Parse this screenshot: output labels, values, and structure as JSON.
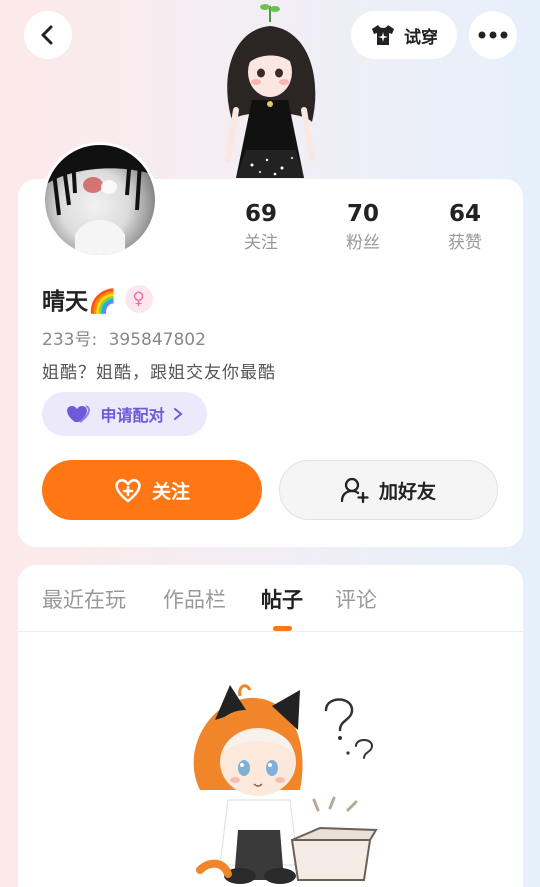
{
  "topbar": {
    "back_icon": "chevron-left-icon",
    "tryon_label": "试穿",
    "tryon_icon": "shirt-sparkle-icon",
    "more_icon": "more-dots-icon"
  },
  "profile": {
    "name": "晴天🌈",
    "gender_icon": "female-icon",
    "gender_symbol": "♀",
    "uid_label": "233号:",
    "uid": "395847802",
    "bio": "姐酷？姐酷，跟姐交友你最酷",
    "stats": [
      {
        "value": "69",
        "label": "关注"
      },
      {
        "value": "70",
        "label": "粉丝"
      },
      {
        "value": "64",
        "label": "获赞"
      }
    ],
    "pair_label": "申请配对",
    "follow_label": "关注",
    "add_friend_label": "加好友"
  },
  "tabs": [
    {
      "label": "最近在玩",
      "active": false
    },
    {
      "label": "作品栏",
      "active": false
    },
    {
      "label": "帖子",
      "active": true
    },
    {
      "label": "评论",
      "active": false
    }
  ],
  "colors": {
    "accent": "#ff7614",
    "pair_bg": "#ece9fb",
    "pair_text": "#6c5ad8",
    "gender_pink": "#f06e9c"
  }
}
